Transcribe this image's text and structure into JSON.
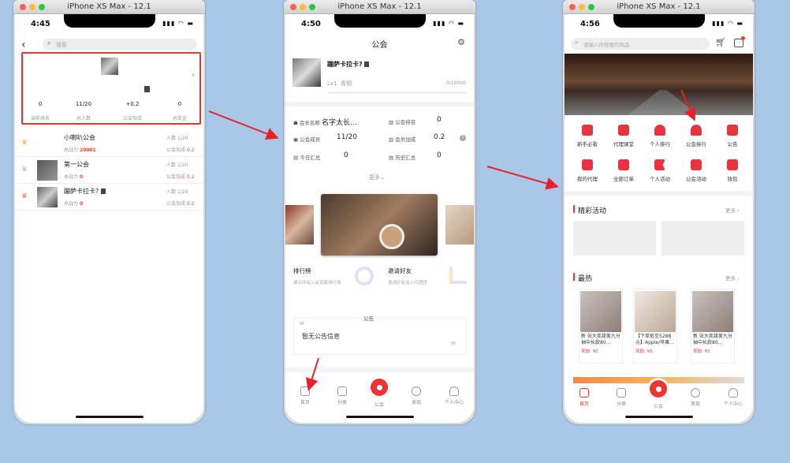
{
  "simulators": [
    {
      "window_title": "iPhone XS Max - 12.1",
      "time": "4:45"
    },
    {
      "window_title": "iPhone XS Max - 12.1",
      "time": "4:50"
    },
    {
      "window_title": "iPhone XS Max - 12.1",
      "time": "4:56"
    }
  ],
  "s1": {
    "search_placeholder": "搜索",
    "stats": [
      {
        "value": "0",
        "label": "当前排名"
      },
      {
        "value": "11/20",
        "label": "总人数"
      },
      {
        "value": "+0.2",
        "label": "公会加成"
      },
      {
        "value": "0",
        "label": "总奖金"
      }
    ],
    "guilds": [
      {
        "name": "小喇叭公会",
        "count_label": "人数",
        "count": "1/20",
        "power_label": "总战力",
        "power": "20001",
        "bonus_label": "公会加成",
        "bonus": "0.2"
      },
      {
        "name": "第一公会",
        "count_label": "人数",
        "count": "1/20",
        "power_label": "总战力",
        "power": "0",
        "bonus_label": "公会加成",
        "bonus": "0.2"
      },
      {
        "name": "蹦萨卡拉卡?",
        "count_label": "人数",
        "count": "1/20",
        "power_label": "总战力",
        "power": "0",
        "bonus_label": "公会加成",
        "bonus": "0.2"
      }
    ]
  },
  "s2": {
    "title": "公会",
    "guild_name": "蹦萨卡拉卡?",
    "level": "Lv1",
    "level_name": "青铜",
    "exp": "0/10000",
    "info": [
      {
        "label": "会长名称",
        "value": "名字太长..."
      },
      {
        "label": "公会排名",
        "value": "0"
      },
      {
        "label": "公会成员",
        "value": "11/20"
      },
      {
        "label": "会员加成",
        "value": "0.2"
      },
      {
        "label": "今日汇总",
        "value": "0"
      },
      {
        "label": "历史汇总",
        "value": "0"
      }
    ],
    "more": "更多",
    "card1_title": "排行榜",
    "card1_sub": "展示所有公会贡献排行榜",
    "card2_title": "邀请好友",
    "card2_sub": "邀请好友加入代理团",
    "notice_label": "公告",
    "notice_text": "暂无公告信息",
    "tabs": [
      "首页",
      "分类",
      "公会",
      "发现",
      "个人中心"
    ]
  },
  "s3": {
    "search_placeholder": "请输入你想要的商品",
    "menu": [
      "新手必看",
      "代理课堂",
      "个人排行",
      "公会排行",
      "公告",
      "我的代理",
      "全部订单",
      "个人活动",
      "公会活动",
      "钱包"
    ],
    "section1": "精彩活动",
    "section2": "最热",
    "more": "更多",
    "products": [
      {
        "name": "新 张大奕甜美九分袖中长款80...",
        "price": "奖励: ¥0"
      },
      {
        "name": "【下单抵至5288元】Apple/苹果...",
        "price": "奖励: ¥0"
      },
      {
        "name": "新 张大奕甜美九分袖中长款80...",
        "price": "奖励: ¥0"
      }
    ],
    "tabs": [
      "首页",
      "分类",
      "公会",
      "发现",
      "个人中心"
    ]
  }
}
